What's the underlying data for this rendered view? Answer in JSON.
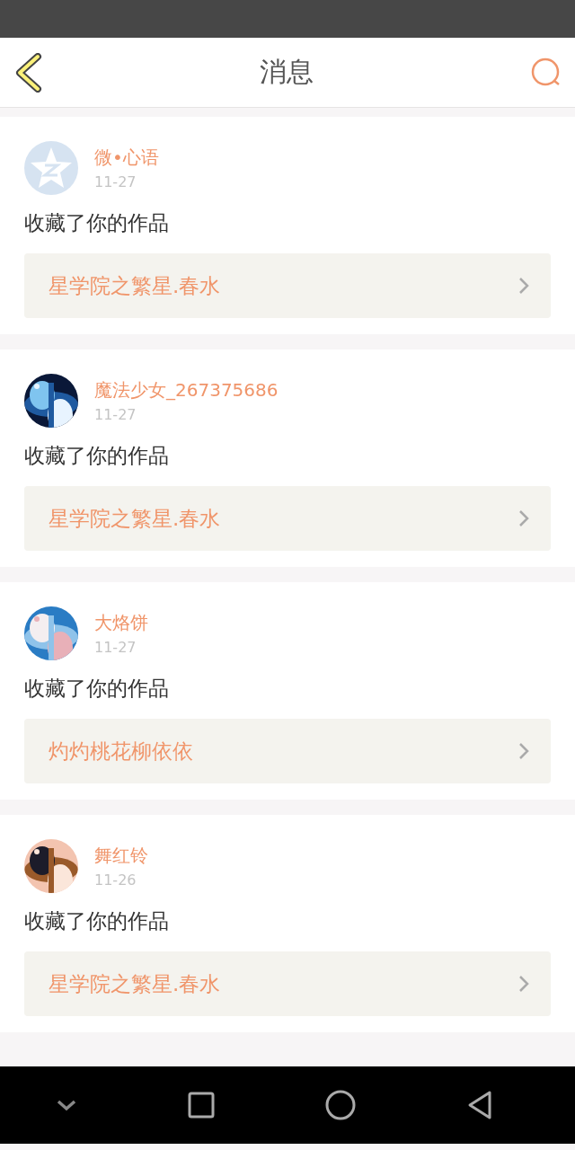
{
  "header": {
    "title": "消息"
  },
  "messages": [
    {
      "avatar": {
        "kind": "icon"
      },
      "name": "微•心语",
      "date": "11-27",
      "text": "收藏了你的作品",
      "work": "星学院之繁星.春水"
    },
    {
      "name": "魔法少女_267375686",
      "date": "11-27",
      "text": "收藏了你的作品",
      "work": "星学院之繁星.春水"
    },
    {
      "name": "大烙饼",
      "date": "11-27",
      "text": "收藏了你的作品",
      "work": "灼灼桃花柳依依"
    },
    {
      "name": "舞红铃",
      "date": "11-26",
      "text": "收藏了你的作品",
      "work": "星学院之繁星.春水"
    }
  ]
}
